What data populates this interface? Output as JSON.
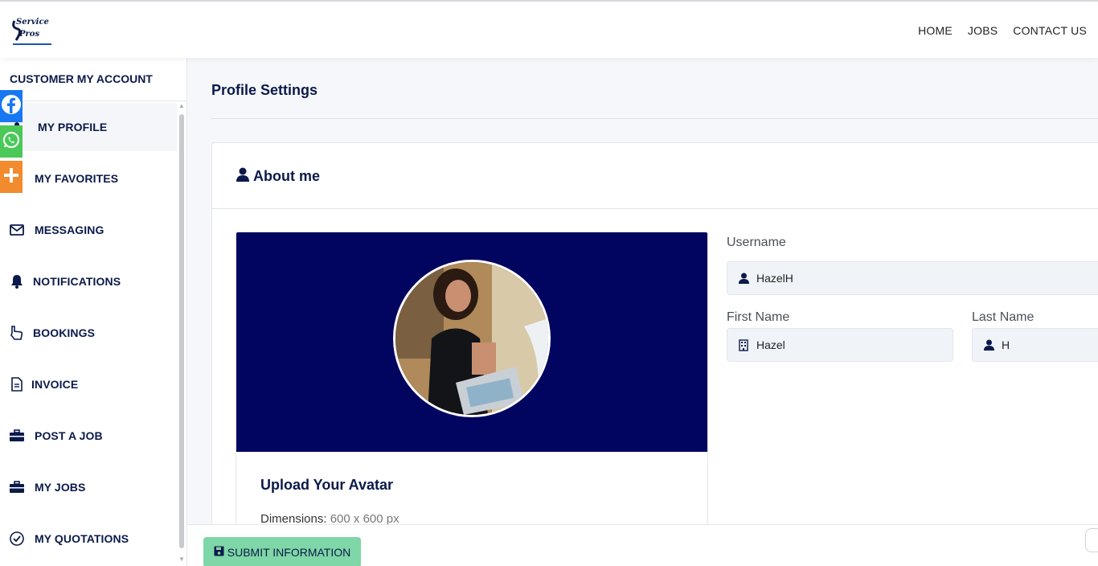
{
  "header": {
    "logo_text_1": "Service",
    "logo_text_2": "Pros",
    "nav": [
      "HOME",
      "JOBS",
      "CONTACT US"
    ]
  },
  "sidebar": {
    "title": "CUSTOMER MY ACCOUNT",
    "items": [
      {
        "label": "MY PROFILE",
        "icon": "user-icon"
      },
      {
        "label": "MY FAVORITES",
        "icon": "heart-icon"
      },
      {
        "label": "MESSAGING",
        "icon": "envelope-icon"
      },
      {
        "label": "NOTIFICATIONS",
        "icon": "bell-icon"
      },
      {
        "label": "BOOKINGS",
        "icon": "hand-pointer-icon"
      },
      {
        "label": "INVOICE",
        "icon": "document-icon"
      },
      {
        "label": "POST A JOB",
        "icon": "briefcase-icon"
      },
      {
        "label": "MY JOBS",
        "icon": "briefcase-icon"
      },
      {
        "label": "MY QUOTATIONS",
        "icon": "check-circle-icon"
      }
    ]
  },
  "share": [
    "facebook-icon",
    "whatsapp-icon",
    "plus-icon"
  ],
  "main": {
    "page_title": "Profile Settings",
    "section_title": "About me",
    "upload_title": "Upload Your Avatar",
    "dimensions_label": "Dimensions:",
    "dimensions_value": "600 x 600 px"
  },
  "form": {
    "username_label": "Username",
    "username_value": "HazelH",
    "first_name_label": "First Name",
    "first_name_value": "Hazel",
    "last_name_label": "Last Name",
    "last_name_value": "H"
  },
  "footer": {
    "submit_label": "SUBMIT INFORMATION"
  },
  "colors": {
    "navy": "#0b1a4a",
    "banner": "#020560",
    "submit": "#7fd6a6",
    "facebook": "#1877f2",
    "whatsapp": "#4ac959",
    "share_more": "#f28a2e"
  }
}
